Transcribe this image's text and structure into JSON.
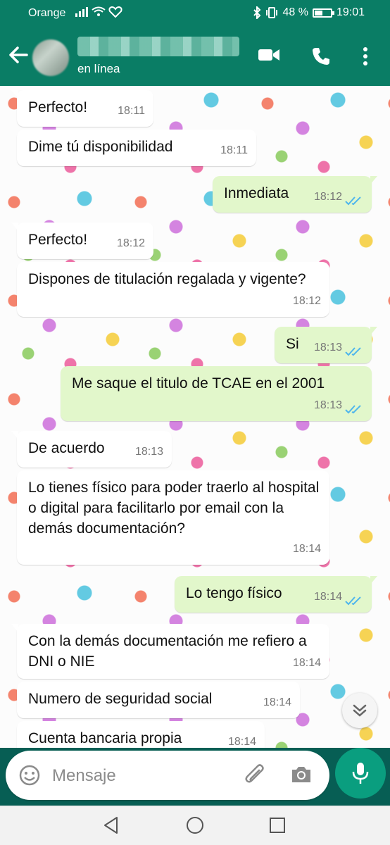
{
  "status_bar": {
    "carrier": "Orange",
    "battery": "48 %",
    "battery_level": 0.48,
    "time": "19:01"
  },
  "header": {
    "status": "en línea",
    "icons": [
      "back-arrow-icon",
      "video-call-icon",
      "phone-icon",
      "more-vert-icon"
    ]
  },
  "messages": [
    {
      "dir": "in",
      "text": "Perfecto!",
      "time": "18:11"
    },
    {
      "dir": "in",
      "text": "Dime tú disponibilidad",
      "time": "18:11"
    },
    {
      "dir": "out",
      "text": "Inmediata",
      "time": "18:12"
    },
    {
      "dir": "in",
      "text": "Perfecto!",
      "time": "18:12"
    },
    {
      "dir": "in",
      "text": "Dispones de titulación regalada y vigente?",
      "time": "18:12"
    },
    {
      "dir": "out",
      "text": "Si",
      "time": "18:13"
    },
    {
      "dir": "out",
      "text": "Me saque el titulo de TCAE en el 2001",
      "time": "18:13"
    },
    {
      "dir": "in",
      "text": "De acuerdo",
      "time": "18:13"
    },
    {
      "dir": "in",
      "text": "Lo tienes físico para poder traerlo al hospital o digital para facilitarlo por email con la demás documentación?",
      "time": "18:14"
    },
    {
      "dir": "out",
      "text": "Lo tengo físico",
      "time": "18:14"
    },
    {
      "dir": "in",
      "text": "Con la demás documentación me refiero a DNI o NIE",
      "time": "18:14"
    },
    {
      "dir": "in",
      "text": "Numero de seguridad social",
      "time": "18:14"
    },
    {
      "dir": "in",
      "text": "Cuenta bancaria propia",
      "time": "18:14"
    }
  ],
  "input": {
    "placeholder": "Mensaje"
  },
  "colors": {
    "header": "#0a7d65",
    "outgoing_bubble": "#e2f7cb",
    "incoming_bubble": "#ffffff",
    "accent": "#0a9e7f",
    "read_ticks": "#4fb6ec"
  }
}
